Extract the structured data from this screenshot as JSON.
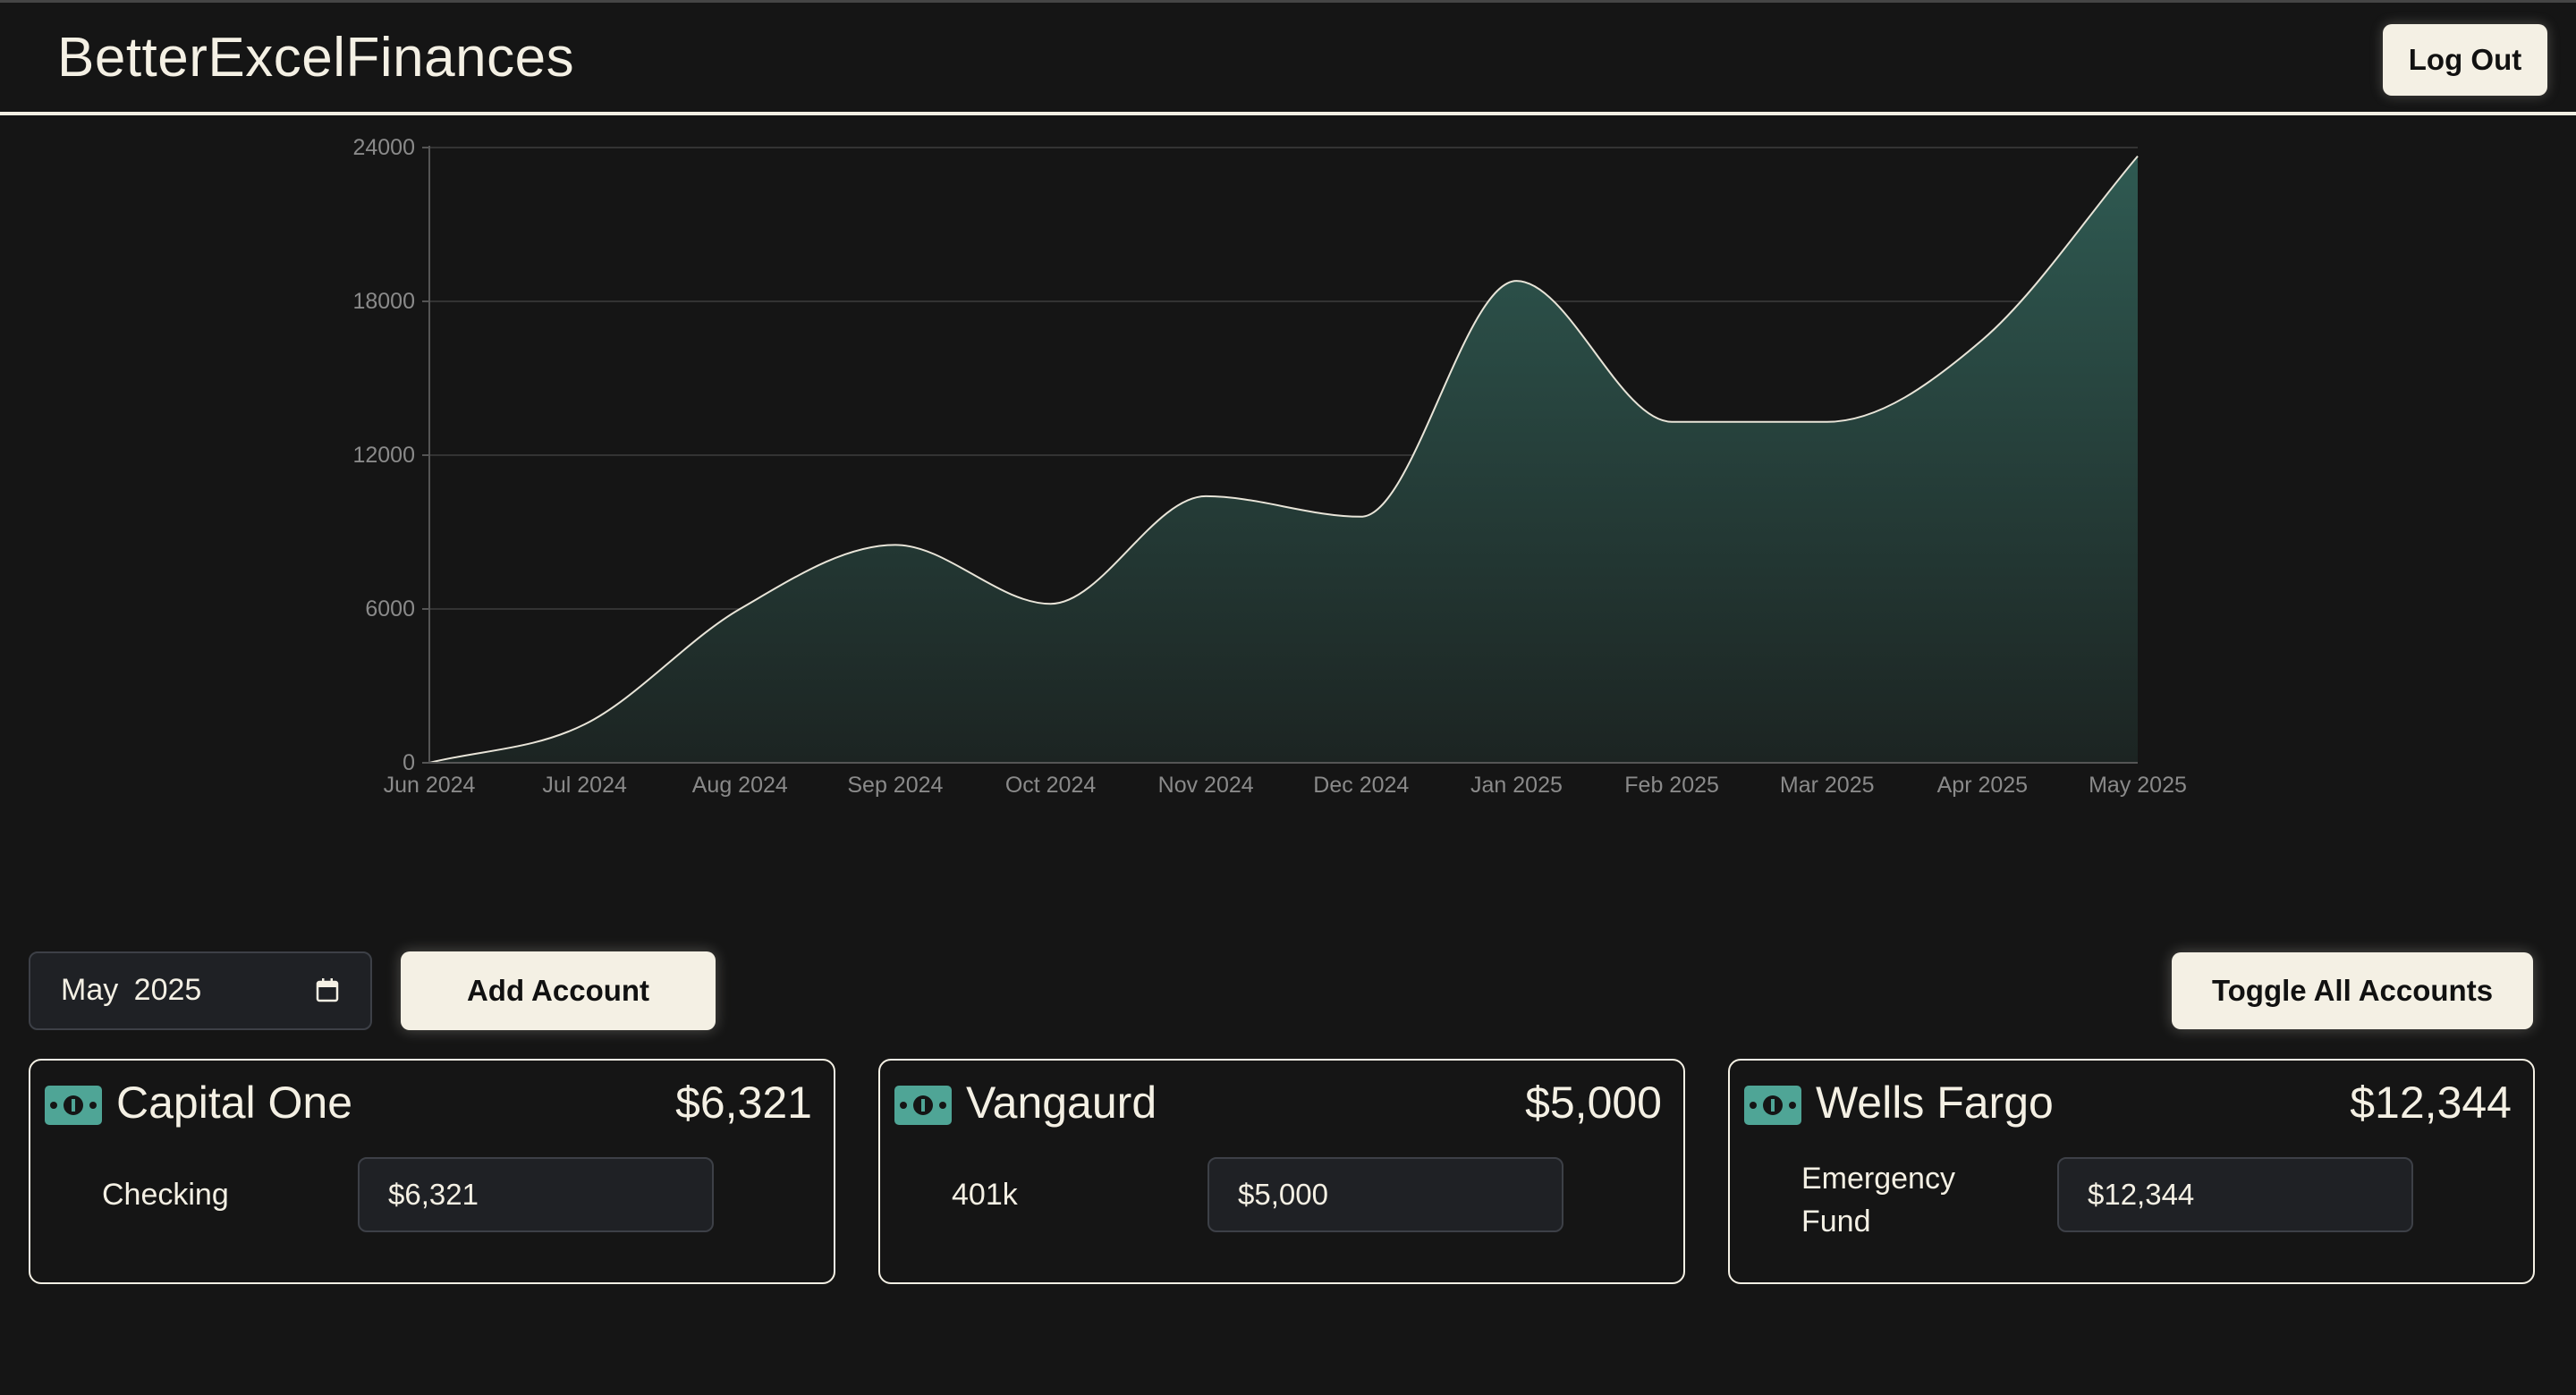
{
  "app": {
    "title": "BetterExcelFinances"
  },
  "header": {
    "logout_label": "Log Out"
  },
  "colors": {
    "background": "#151515",
    "accent_light": "#f4f0e4",
    "area_fill": "#2f5a52",
    "icon_green": "#4fa596"
  },
  "chart_data": {
    "type": "area",
    "x": [
      "Jun 2024",
      "Jul 2024",
      "Aug 2024",
      "Sep 2024",
      "Oct 2024",
      "Nov 2024",
      "Dec 2024",
      "Jan 2025",
      "Feb 2025",
      "Mar 2025",
      "Apr 2025",
      "May 2025"
    ],
    "values": [
      0,
      1500,
      6000,
      8500,
      6200,
      10400,
      9600,
      18800,
      13300,
      13300,
      16500,
      23665
    ],
    "ylim": [
      0,
      24000
    ],
    "yticks": [
      0,
      6000,
      12000,
      18000,
      24000
    ],
    "grid": true,
    "title": "",
    "xlabel": "",
    "ylabel": ""
  },
  "controls": {
    "date_value": "May 2025",
    "calendar_icon": "calendar-icon",
    "add_account_label": "Add Account",
    "toggle_all_label": "Toggle All Accounts"
  },
  "accounts": [
    {
      "name": "Capital One",
      "total": "$6,321",
      "icon": "money-icon",
      "sub_label": "Checking",
      "sub_value": "$6,321"
    },
    {
      "name": "Vangaurd",
      "total": "$5,000",
      "icon": "money-icon",
      "sub_label": "401k",
      "sub_value": "$5,000"
    },
    {
      "name": "Wells Fargo",
      "total": "$12,344",
      "icon": "money-icon",
      "sub_label": "Emergency Fund",
      "sub_value": "$12,344"
    }
  ]
}
